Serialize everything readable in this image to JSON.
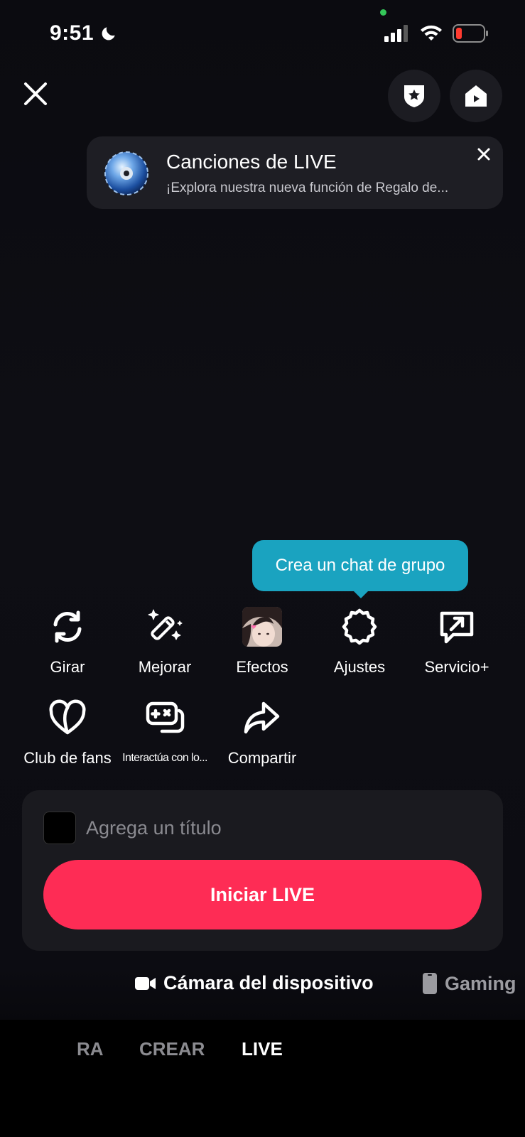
{
  "status_bar": {
    "time": "9:51"
  },
  "banner": {
    "title": "Canciones de LIVE",
    "subtitle": "¡Explora nuestra nueva función de Regalo de..."
  },
  "tooltip": {
    "text": "Crea un chat de grupo"
  },
  "tools": [
    {
      "label": "Girar",
      "icon": "rotate-icon"
    },
    {
      "label": "Mejorar",
      "icon": "magic-wand-icon"
    },
    {
      "label": "Efectos",
      "icon": "effects-thumbnail"
    },
    {
      "label": "Ajustes",
      "icon": "gear-icon"
    },
    {
      "label": "Servicio+",
      "icon": "service-plus-icon"
    },
    {
      "label": "Club de fans",
      "icon": "heart-icon"
    },
    {
      "label": "Interactúa con lo...",
      "icon": "game-controller-icon"
    },
    {
      "label": "Compartir",
      "icon": "share-arrow-icon"
    }
  ],
  "card": {
    "title_placeholder": "Agrega un título",
    "start_label": "Iniciar LIVE"
  },
  "sources": {
    "active": "Cámara del dispositivo",
    "inactive": "Gaming"
  },
  "modes": {
    "partial": "RA",
    "crear": "CREAR",
    "live": "LIVE"
  },
  "colors": {
    "accent": "#fe2c55",
    "tooltip": "#1aa3c0",
    "battery_low": "#ff3b30"
  }
}
